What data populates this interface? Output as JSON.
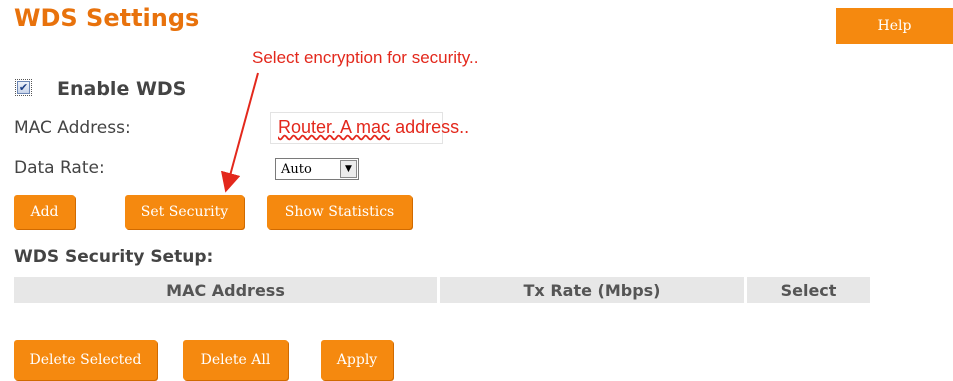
{
  "page": {
    "title": "WDS Settings",
    "help_label": "Help"
  },
  "annotations": {
    "security_note": "Select encryption for security..",
    "mac_note_underlined": "Router. A mac",
    "mac_note_rest": " address.."
  },
  "form": {
    "enable_wds": {
      "label": "Enable WDS",
      "checked": true
    },
    "mac_address_label": "MAC Address:",
    "data_rate_label": "Data Rate:",
    "data_rate_value": "Auto"
  },
  "buttons": {
    "add": "Add",
    "set_security": "Set Security",
    "show_statistics": "Show Statistics",
    "delete_selected": "Delete Selected",
    "delete_all": "Delete All",
    "apply": "Apply"
  },
  "security_setup": {
    "heading": "WDS Security Setup:",
    "columns": [
      "MAC Address",
      "Tx Rate (Mbps)",
      "Select"
    ],
    "rows": []
  },
  "colors": {
    "accent": "#f5890f",
    "title": "#e8720c",
    "annotation": "#e3281c",
    "table_header": "#e7e7e7"
  },
  "icons": {
    "checkbox": "check-icon",
    "dropdown": "chevron-down-icon",
    "annotation_arrow": "arrow-icon"
  }
}
